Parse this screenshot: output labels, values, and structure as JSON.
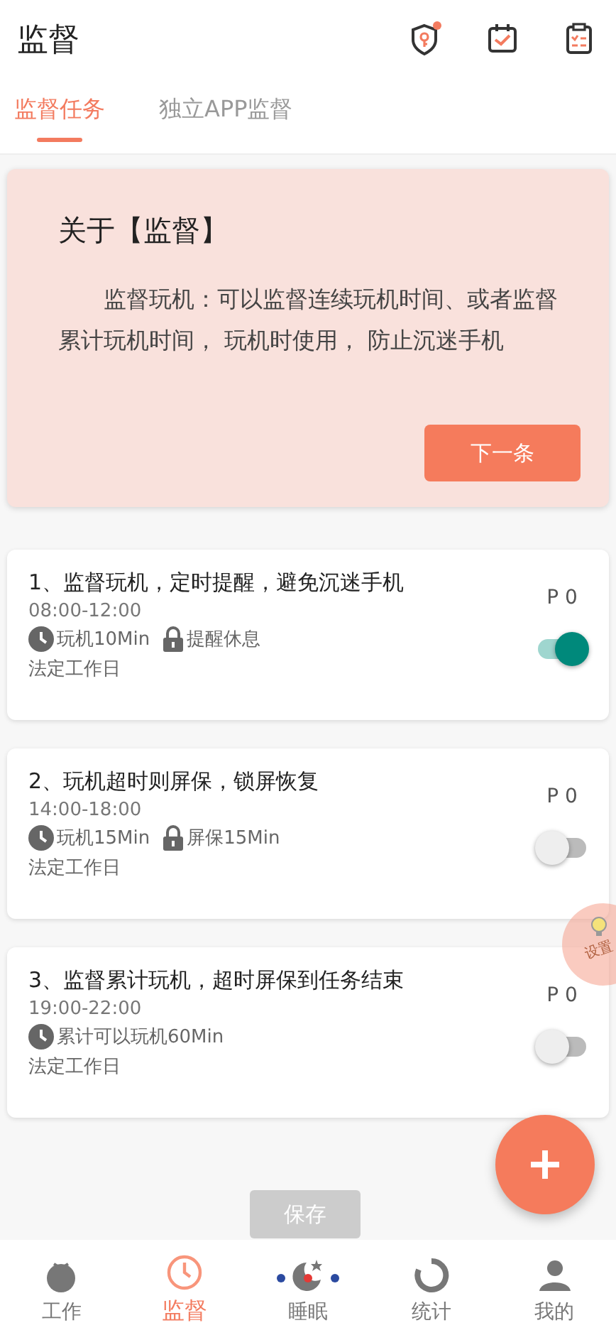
{
  "header": {
    "title": "监督",
    "notification_dot": true
  },
  "tabs": [
    {
      "label": "监督任务",
      "selected": true
    },
    {
      "label": "独立APP监督",
      "selected": false
    }
  ],
  "banner": {
    "title": "关于【监督】",
    "text": "监督玩机：可以监督连续玩机时间、或者监督累计玩机时间， 玩机时使用， 防止沉迷手机",
    "button": "下一条"
  },
  "tasks": [
    {
      "title": "1、监督玩机，定时提醒，避免沉迷手机",
      "time": "08:00-12:00",
      "tags": [
        {
          "kind": "clock",
          "text": "玩机10Min"
        },
        {
          "kind": "lock",
          "text": "提醒休息"
        }
      ],
      "days": "法定工作日",
      "priority": "P 0",
      "on": true
    },
    {
      "title": "2、玩机超时则屏保，锁屏恢复",
      "time": "14:00-18:00",
      "tags": [
        {
          "kind": "clock",
          "text": "玩机15Min"
        },
        {
          "kind": "lock",
          "text": "屏保15Min"
        }
      ],
      "days": "法定工作日",
      "priority": "P 0",
      "on": false
    },
    {
      "title": "3、监督累计玩机，超时屏保到任务结束",
      "time": "19:00-22:00",
      "tags": [
        {
          "kind": "clock",
          "text": "累计可以玩机60Min"
        }
      ],
      "days": "法定工作日",
      "priority": "P 0",
      "on": false
    }
  ],
  "floating_tip": {
    "text": "设置"
  },
  "save_button": {
    "label": "保存",
    "disabled": true
  },
  "nav": [
    {
      "kind": "tomato",
      "label": "工作",
      "selected": false
    },
    {
      "kind": "clock",
      "label": "监督",
      "selected": true
    },
    {
      "kind": "moon",
      "label": "睡眠",
      "selected": false
    },
    {
      "kind": "ring",
      "label": "统计",
      "selected": false
    },
    {
      "kind": "person",
      "label": "我的",
      "selected": false
    }
  ]
}
